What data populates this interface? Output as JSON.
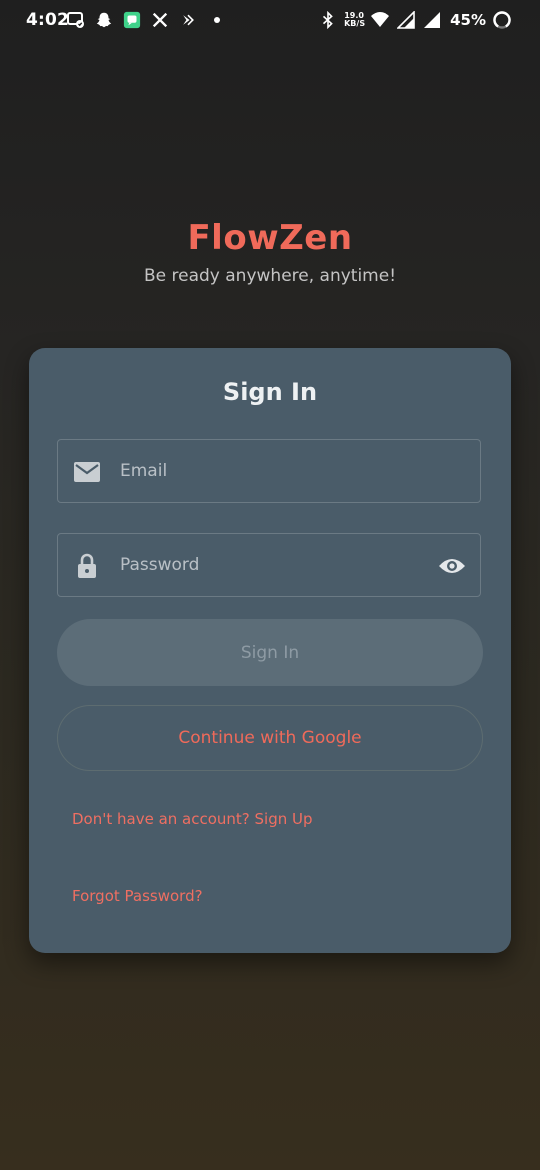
{
  "status_bar": {
    "time": "4:02",
    "network_speed_value": "19.0",
    "network_speed_unit": "KB/S",
    "battery_percent": "45%",
    "icons_left": [
      "chat-bubble-icon",
      "snapchat-icon",
      "messages-app-icon",
      "x-app-icon",
      "arrow-app-icon",
      "notification-dot-icon"
    ],
    "icons_right": [
      "bluetooth-icon",
      "wifi-icon",
      "signal-icon",
      "signal-icon",
      "battery-ring-icon"
    ]
  },
  "brand": {
    "app_name": "FlowZen",
    "tagline": "Be ready anywhere, anytime!"
  },
  "signin": {
    "title": "Sign In",
    "email_placeholder": "Email",
    "password_placeholder": "Password",
    "signin_button": "Sign In",
    "google_button": "Continue with Google",
    "signup_link": "Don't have an account? Sign Up",
    "forgot_link": "Forgot Password?"
  },
  "colors": {
    "accent": "#f06a5a",
    "card": "#4a5c69",
    "disabled_button": "#5c6d78"
  }
}
